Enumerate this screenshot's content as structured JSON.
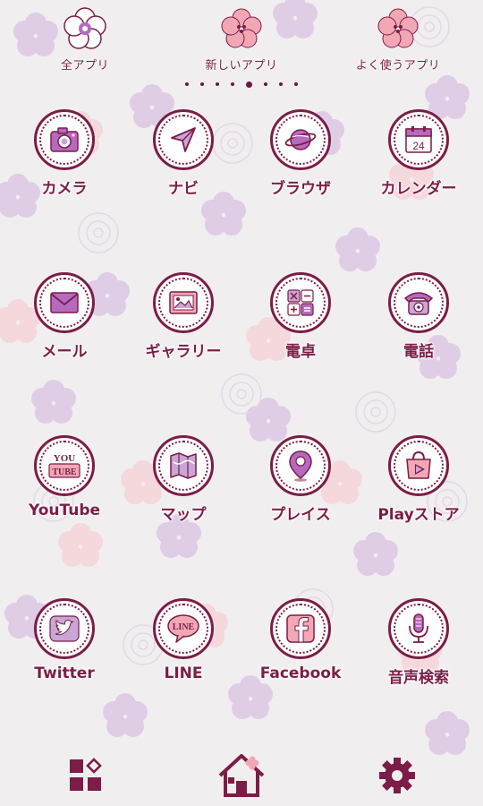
{
  "top_bar": [
    {
      "label": "全アプリ",
      "icon": "flower-white-icon"
    },
    {
      "label": "新しいアプリ",
      "icon": "flower-pink-icon"
    },
    {
      "label": "よく使うアプリ",
      "icon": "flower-pink-icon"
    }
  ],
  "pager": {
    "count": 8,
    "active": 4
  },
  "apps": [
    {
      "label": "カメラ",
      "icon": "camera-icon"
    },
    {
      "label": "ナビ",
      "icon": "navigation-arrow-icon"
    },
    {
      "label": "ブラウザ",
      "icon": "planet-icon"
    },
    {
      "label": "カレンダー",
      "icon": "calendar-icon",
      "date": "24"
    },
    {
      "label": "メール",
      "icon": "envelope-icon"
    },
    {
      "label": "ギャラリー",
      "icon": "picture-icon"
    },
    {
      "label": "電卓",
      "icon": "calculator-icon"
    },
    {
      "label": "電話",
      "icon": "telephone-icon"
    },
    {
      "label": "YouTube",
      "icon": "youtube-icon",
      "icon_text_top": "YOU",
      "icon_text_bottom": "TUBE"
    },
    {
      "label": "マップ",
      "icon": "map-icon"
    },
    {
      "label": "プレイス",
      "icon": "location-pin-icon"
    },
    {
      "label": "Playストア",
      "icon": "shopping-bag-play-icon"
    },
    {
      "label": "Twitter",
      "icon": "bird-icon"
    },
    {
      "label": "LINE",
      "icon": "line-bubble-icon",
      "icon_text": "LINE"
    },
    {
      "label": "Facebook",
      "icon": "facebook-icon"
    },
    {
      "label": "音声検索",
      "icon": "microphone-icon"
    }
  ],
  "dock": [
    "app-drawer-icon",
    "home-icon",
    "gear-icon"
  ],
  "colors": {
    "accent": "#7b1d47",
    "pink": "#f2a7b5",
    "lavender": "#c9a6d6",
    "background": "#f1eef0"
  }
}
